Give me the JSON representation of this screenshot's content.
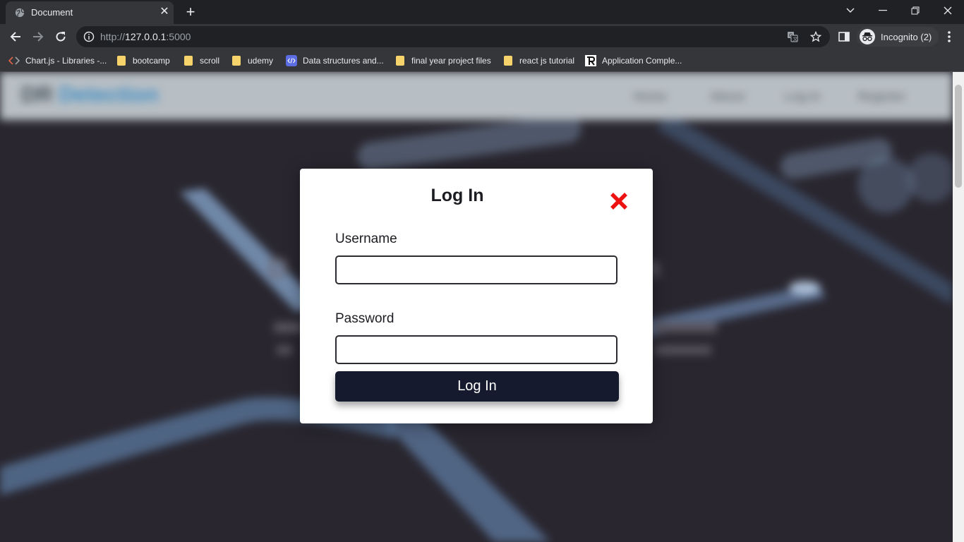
{
  "browser": {
    "tab": {
      "title": "Document"
    },
    "url": {
      "scheme": "http://",
      "host": "127.0.0.1",
      "port": ":5000"
    },
    "incognito_label": "Incognito (2)",
    "bookmarks": [
      {
        "label": "Chart.js - Libraries -...",
        "icon": "chartjs-icon"
      },
      {
        "label": "bootcamp",
        "icon": "folder-icon"
      },
      {
        "label": "scroll",
        "icon": "folder-icon"
      },
      {
        "label": "udemy",
        "icon": "folder-icon"
      },
      {
        "label": "Data structures and...",
        "icon": "code-icon"
      },
      {
        "label": "final year project files",
        "icon": "folder-icon"
      },
      {
        "label": "react js tutorial",
        "icon": "folder-icon"
      },
      {
        "label": "Application Comple...",
        "icon": "r-logo-icon"
      }
    ]
  },
  "site": {
    "brand_part1": "DR",
    "brand_part2": "Detection",
    "nav": [
      "Home",
      "About",
      "Log In",
      "Register"
    ],
    "hero_fragment_left": "D",
    "hero_fragment_right": "ction"
  },
  "modal": {
    "title": "Log In",
    "username_label": "Username",
    "username_value": "",
    "password_label": "Password",
    "password_value": "",
    "submit_label": "Log In"
  },
  "colors": {
    "close_icon": "#ee1111",
    "submit_bg": "#161a2e",
    "brand_accent": "#3f8ec3"
  }
}
